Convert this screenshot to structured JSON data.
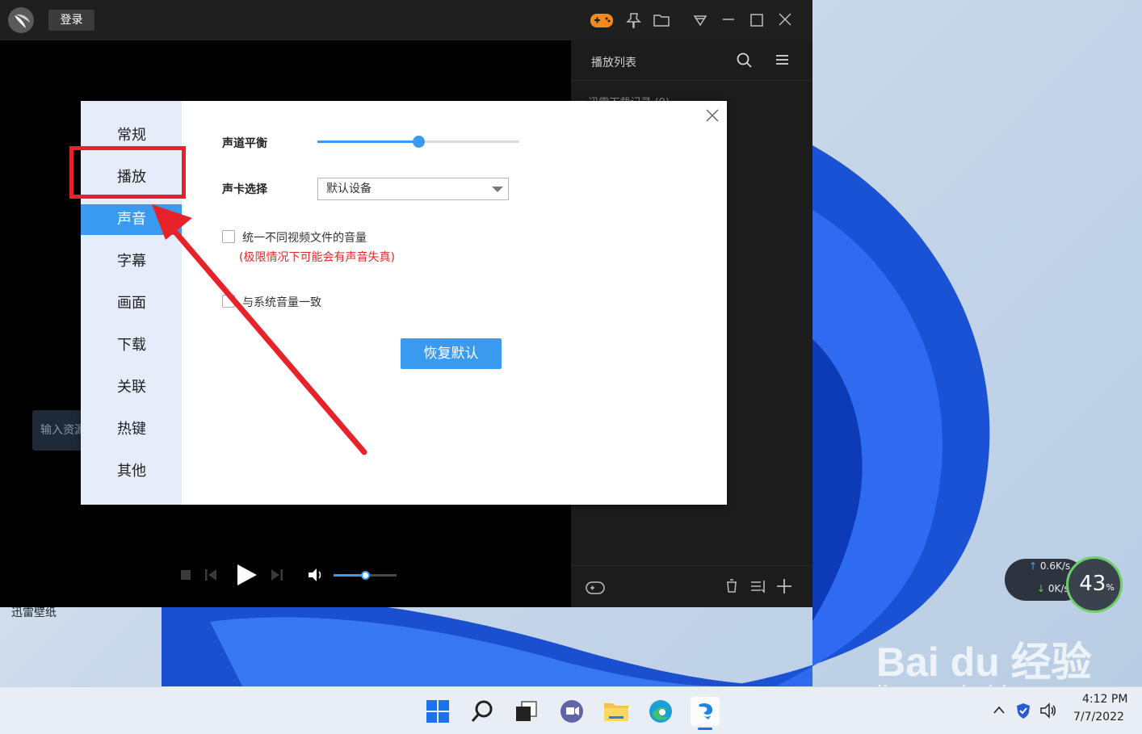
{
  "titlebar": {
    "login_label": "登录"
  },
  "playlist": {
    "title": "播放列表",
    "folder": "迅雷下载记录 (0)"
  },
  "player": {
    "input_placeholder": "输入资源"
  },
  "dialog": {
    "nav": [
      {
        "label": "常规",
        "active": false
      },
      {
        "label": "播放",
        "active": false
      },
      {
        "label": "声音",
        "active": true
      },
      {
        "label": "字幕",
        "active": false
      },
      {
        "label": "画面",
        "active": false
      },
      {
        "label": "下载",
        "active": false
      },
      {
        "label": "关联",
        "active": false
      },
      {
        "label": "热键",
        "active": false
      },
      {
        "label": "其他",
        "active": false
      }
    ],
    "balance_label": "声道平衡",
    "balance_value": 0.5,
    "soundcard_label": "声卡选择",
    "soundcard_value": "默认设备",
    "unify_volume_label": "统一不同视频文件的音量",
    "unify_volume_warning": "(极限情况下可能会有声音失真)",
    "unify_volume_checked": false,
    "system_volume_label": "与系统音量一致",
    "system_volume_checked": false,
    "reset_label": "恢复默认"
  },
  "desktop": {
    "label": "迅雷壁纸"
  },
  "net_widget": {
    "up": "0.6K/s",
    "down": "0K/s",
    "percent": "43",
    "percent_unit": "%"
  },
  "watermark": {
    "brand": "Bai du 经验",
    "sub": "jingyan.baidu.com"
  },
  "taskbar": {
    "time": "4:12 PM",
    "date": "7/7/2022"
  },
  "colors": {
    "accent": "#3a9af0",
    "annotation": "#e8222a",
    "warning": "#e22a2a"
  }
}
